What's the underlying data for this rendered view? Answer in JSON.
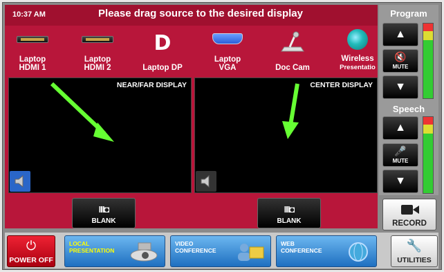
{
  "header": {
    "time": "10:37 AM",
    "instruction": "Please drag source to the desired display"
  },
  "sources": [
    {
      "label_line1": "Laptop",
      "label_line2": "HDMI 1",
      "icon": "hdmi-port-icon"
    },
    {
      "label_line1": "Laptop",
      "label_line2": "HDMI 2",
      "icon": "hdmi-port-icon"
    },
    {
      "label_line1": "",
      "label_line2": "Laptop DP",
      "icon": "displayport-logo-icon"
    },
    {
      "label_line1": "Laptop",
      "label_line2": "VGA",
      "icon": "vga-port-icon"
    },
    {
      "label_line1": "",
      "label_line2": "Doc Cam",
      "icon": "document-camera-icon"
    },
    {
      "label_line1": "Wireless",
      "label_line2": "Presentatio",
      "icon": "wireless-presentation-icon"
    }
  ],
  "displays": [
    {
      "label": "NEAR/FAR DISPLAY",
      "blank_label": "BLANK"
    },
    {
      "label": "CENTER DISPLAY",
      "blank_label": "BLANK"
    }
  ],
  "volume": {
    "program_label": "Program",
    "speech_label": "Speech",
    "mute_label": "MUTE"
  },
  "record_label": "RECORD",
  "bottom": {
    "power_label": "POWER OFF",
    "modes": [
      {
        "line1": "LOCAL",
        "line2": "PRESENTATION",
        "active": true
      },
      {
        "line1": "VIDEO",
        "line2": "CONFERENCE",
        "active": false
      },
      {
        "line1": "WEB",
        "line2": "CONFERENCE",
        "active": false
      }
    ],
    "utilities_label": "UTILITIES"
  },
  "colors": {
    "panel_red": "#b8163a",
    "highlight_arrow": "#66ff33",
    "mode_blue": "#1e6fc0"
  }
}
